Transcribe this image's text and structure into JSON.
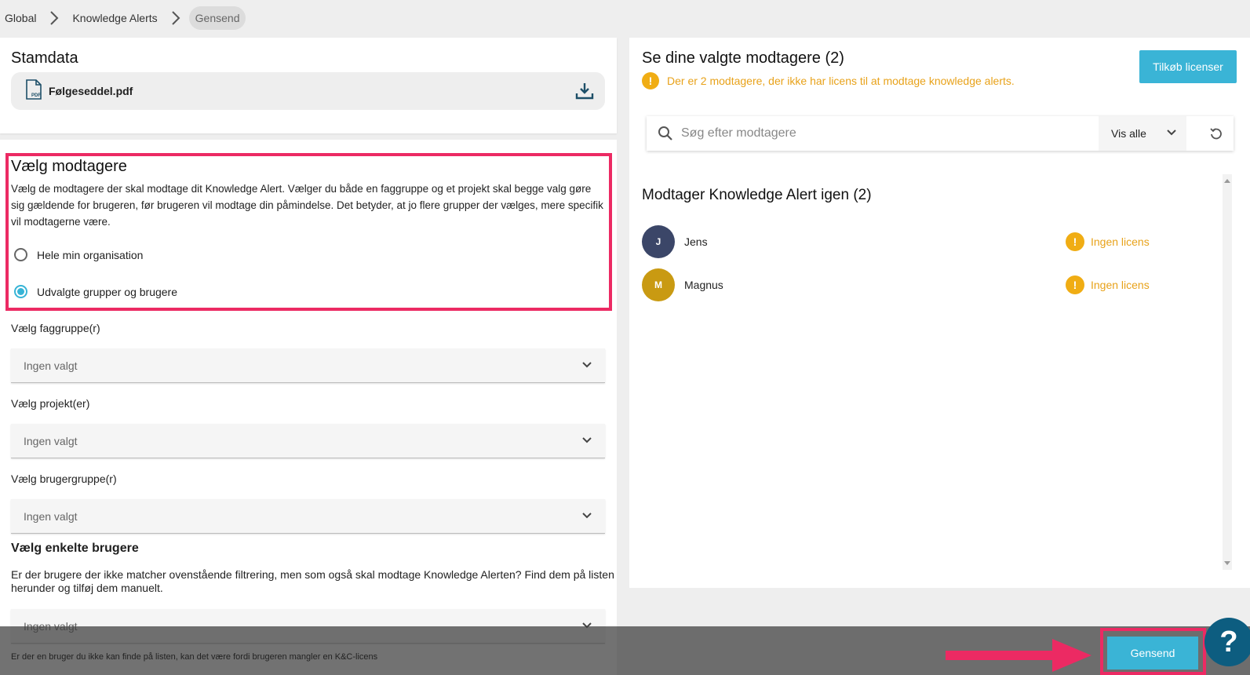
{
  "breadcrumb": {
    "items": [
      "Global",
      "Knowledge Alerts"
    ],
    "current": "Gensend"
  },
  "stamdata": {
    "title": "Stamdata",
    "file_name": "Følgeseddel.pdf",
    "file_icon": "pdf-file-icon",
    "download_icon": "download-icon"
  },
  "recipients": {
    "title": "Vælg modtagere",
    "description": "Vælg de modtagere der skal modtage dit Knowledge Alert. Vælger du både en faggruppe og et projekt skal begge valg gøre sig gældende for brugeren, før brugeren vil modtage din påmindelse. Det betyder, at jo flere grupper der vælges, mere specifik vil modtagerne være.",
    "options": [
      {
        "label": "Hele min organisation",
        "checked": false
      },
      {
        "label": "Udvalgte grupper og brugere",
        "checked": true
      }
    ]
  },
  "fields": {
    "faggruppe": {
      "label": "Vælg faggruppe(r)",
      "value": "Ingen valgt"
    },
    "projekt": {
      "label": "Vælg projekt(er)",
      "value": "Ingen valgt"
    },
    "brugergruppe": {
      "label": "Vælg brugergruppe(r)",
      "value": "Ingen valgt"
    }
  },
  "single_users": {
    "title": "Vælg enkelte brugere",
    "description": "Er der brugere der ikke matcher ovenstående filtrering, men som også skal modtage Knowledge Alerten? Find dem på listen herunder og tilføj dem manuelt.",
    "value": "Ingen valgt",
    "note": "Er der en bruger du ikke kan finde på listen, kan det være fordi brugeren mangler en K&C-licens"
  },
  "selected": {
    "title": "Se dine valgte modtagere (2)",
    "warning": "Der er 2 modtagere, der ikke har licens til at modtage knowledge alerts.",
    "buy_label": "Tilkøb licenser",
    "search_placeholder": "Søg efter modtagere",
    "filter_value": "Vis alle",
    "list_title": "Modtager Knowledge Alert igen (2)",
    "people": [
      {
        "initial": "J",
        "name": "Jens",
        "status": "Ingen licens",
        "color": "#3b4668"
      },
      {
        "initial": "M",
        "name": "Magnus",
        "status": "Ingen licens",
        "color": "#c99a12"
      }
    ]
  },
  "actions": {
    "send_label": "Gensend",
    "help_label": "?"
  },
  "colors": {
    "accent": "#3ab4d6",
    "warning": "#f0ad14",
    "highlight": "#ec2a63"
  }
}
